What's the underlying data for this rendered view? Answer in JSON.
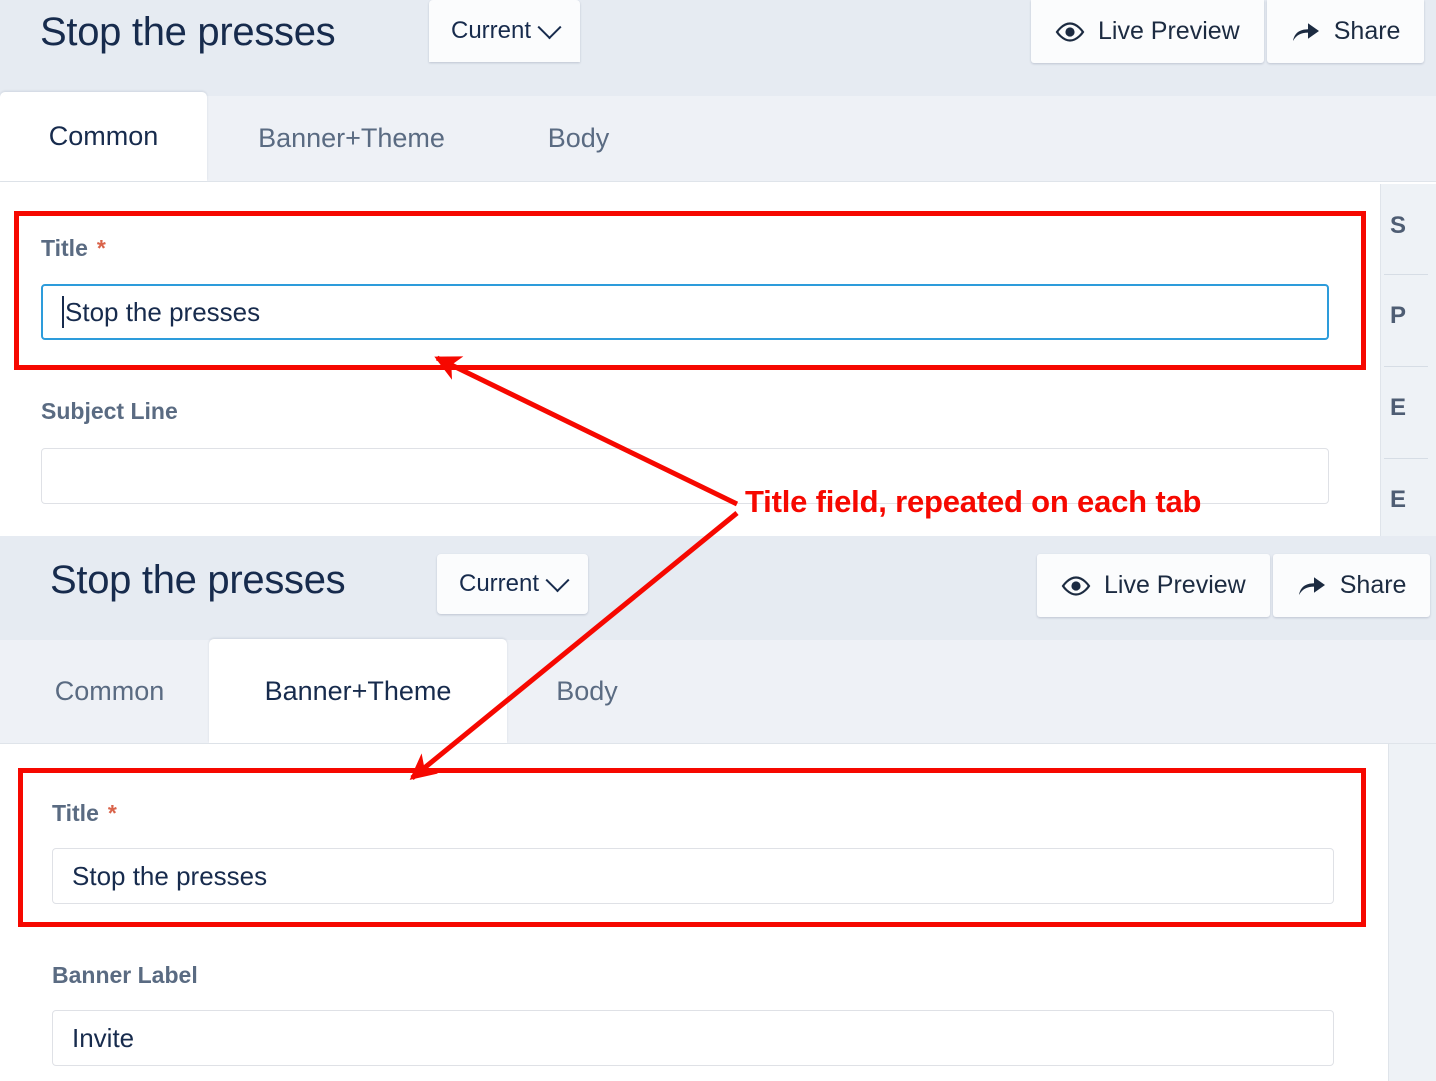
{
  "colors": {
    "header_bg": "#e6ebf2",
    "tabbar_bg": "#eef1f6",
    "accent_focus": "#2d9cdb",
    "annotation_red": "#f60800",
    "required_star": "#d9634a",
    "label_text": "#5a6b82",
    "rail_dark": "#253241"
  },
  "panels": [
    {
      "header": {
        "doc_title": "Stop the presses",
        "version_selector": {
          "label": "Current",
          "icon": "chevron-down-icon"
        },
        "actions": [
          {
            "label": "Live Preview",
            "icon": "eye-icon"
          },
          {
            "label": "Share",
            "icon": "share-arrow-icon"
          }
        ]
      },
      "tabs": [
        {
          "label": "Common",
          "active": true
        },
        {
          "label": "Banner+Theme",
          "active": false
        },
        {
          "label": "Body",
          "active": false
        }
      ],
      "fields": [
        {
          "label": "Title",
          "required": true,
          "required_marker": "*",
          "value": "Stop the presses",
          "focused": true
        },
        {
          "label": "Subject Line",
          "required": false,
          "required_marker": "",
          "value": "",
          "focused": false
        }
      ],
      "side_rail": [
        "S",
        "P",
        "E",
        "E"
      ]
    },
    {
      "header": {
        "doc_title": "Stop the presses",
        "version_selector": {
          "label": "Current",
          "icon": "chevron-down-icon"
        },
        "actions": [
          {
            "label": "Live Preview",
            "icon": "eye-icon"
          },
          {
            "label": "Share",
            "icon": "share-arrow-icon"
          }
        ]
      },
      "tabs": [
        {
          "label": "Common",
          "active": false
        },
        {
          "label": "Banner+Theme",
          "active": true
        },
        {
          "label": "Body",
          "active": false
        }
      ],
      "fields": [
        {
          "label": "Title",
          "required": true,
          "required_marker": "*",
          "value": "Stop the presses",
          "focused": false
        },
        {
          "label": "Banner Label",
          "required": false,
          "required_marker": "",
          "value": "Invite",
          "focused": false
        }
      ],
      "side_rail": []
    }
  ],
  "annotation": {
    "text": "Title field, repeated on each tab",
    "color": "#f60800"
  }
}
